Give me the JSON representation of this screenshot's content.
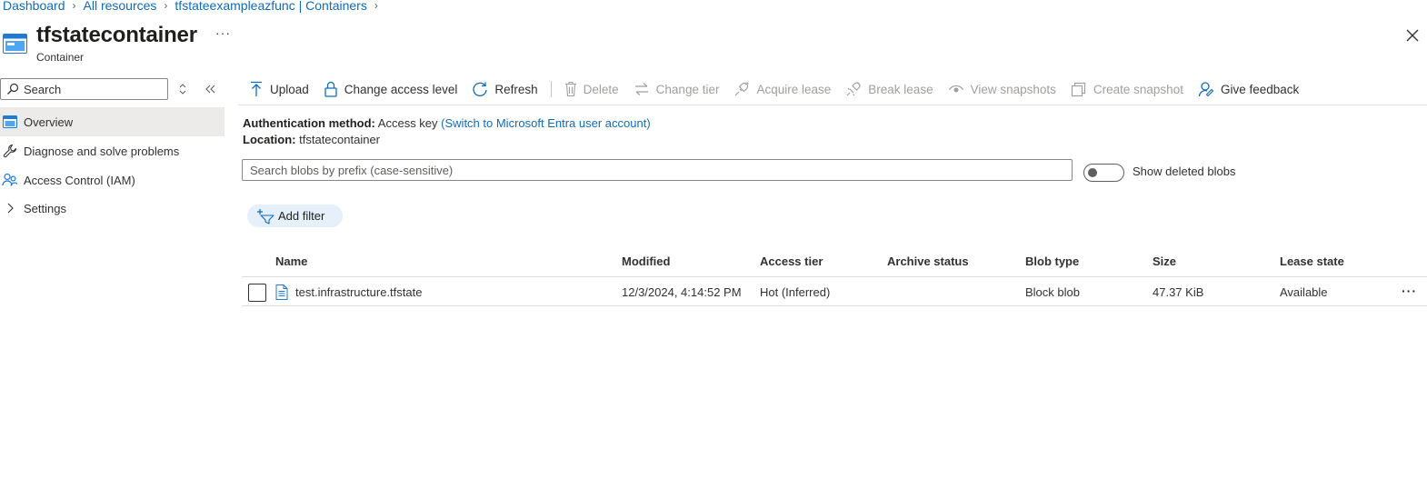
{
  "breadcrumb": [
    {
      "label": "Dashboard"
    },
    {
      "label": "All resources"
    },
    {
      "label": "tfstateexampleazfunc | Containers"
    }
  ],
  "header": {
    "title": "tfstatecontainer",
    "subtitle": "Container",
    "more_label": "···",
    "close_icon": "close-icon"
  },
  "sidebar": {
    "search_placeholder": "Search",
    "items": [
      {
        "label": "Overview",
        "icon": "container-icon",
        "active": true
      },
      {
        "label": "Diagnose and solve problems",
        "icon": "wrench-icon"
      },
      {
        "label": "Access Control (IAM)",
        "icon": "people-icon"
      },
      {
        "label": "Settings",
        "icon": "chevron-right-icon"
      }
    ]
  },
  "toolbar": {
    "upload": "Upload",
    "change_access_level": "Change access level",
    "refresh": "Refresh",
    "delete": "Delete",
    "change_tier": "Change tier",
    "acquire_lease": "Acquire lease",
    "break_lease": "Break lease",
    "view_snapshots": "View snapshots",
    "create_snapshot": "Create snapshot",
    "give_feedback": "Give feedback"
  },
  "info": {
    "auth_label": "Authentication method:",
    "auth_value": "Access key",
    "auth_link": "(Switch to Microsoft Entra user account)",
    "location_label": "Location:",
    "location_value": "tfstatecontainer"
  },
  "blob_search": {
    "placeholder": "Search blobs by prefix (case-sensitive)"
  },
  "show_deleted": {
    "label": "Show deleted blobs",
    "on": false
  },
  "add_filter": "Add filter",
  "table": {
    "columns": [
      "Name",
      "Modified",
      "Access tier",
      "Archive status",
      "Blob type",
      "Size",
      "Lease state"
    ],
    "rows": [
      {
        "name": "test.infrastructure.tfstate",
        "modified": "12/3/2024, 4:14:52 PM",
        "access_tier": "Hot (Inferred)",
        "archive_status": "",
        "blob_type": "Block blob",
        "size": "47.37 KiB",
        "lease_state": "Available",
        "more": "···"
      }
    ]
  },
  "colors": {
    "accent": "#0f6cbd",
    "disabled": "#a19f9d",
    "active_nav": "#edebe9",
    "filter_pill": "#e5f0fb"
  }
}
